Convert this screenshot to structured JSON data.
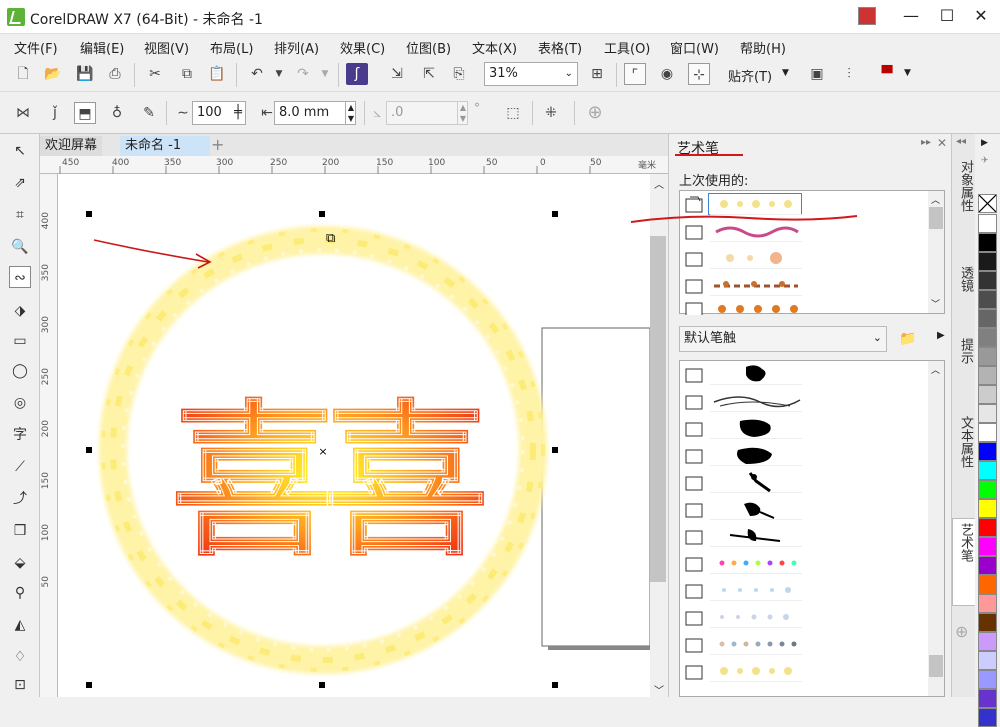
{
  "window": {
    "title": "CorelDRAW X7 (64-Bit) - 未命名 -1"
  },
  "menu": [
    "文件(F)",
    "编辑(E)",
    "视图(V)",
    "布局(L)",
    "排列(A)",
    "效果(C)",
    "位图(B)",
    "文本(X)",
    "表格(T)",
    "工具(O)",
    "窗口(W)",
    "帮助(H)"
  ],
  "toolbar": {
    "zoom": "31%",
    "snap_label": "贴齐(T)"
  },
  "property_bar": {
    "smoothness": "100",
    "width": "8.0 mm",
    "angle": ".0",
    "degree_symbol": "°"
  },
  "doc_tabs": [
    "欢迎屏幕",
    "未命名 -1"
  ],
  "ruler": {
    "h_ticks": [
      "450",
      "400",
      "350",
      "300",
      "250",
      "200",
      "150",
      "100",
      "50",
      "0",
      "50"
    ],
    "h_unit": "毫米",
    "v_ticks": [
      "400",
      "350",
      "300",
      "250",
      "200",
      "150",
      "100",
      "50"
    ]
  },
  "canvas": {
    "art_text": "喜喜"
  },
  "docker": {
    "title": "艺术笔",
    "recent_label": "上次使用的:",
    "category": "默认笔触"
  },
  "side_tabs": [
    "对象属性",
    "透镜",
    "提示",
    "文本属性",
    "艺术笔"
  ],
  "colors": {
    "accent_red": "#d0181e",
    "palette": [
      "#ffffff",
      "#000000",
      "#1a1a1a",
      "#333333",
      "#4d4d4d",
      "#666666",
      "#808080",
      "#999999",
      "#b3b3b3",
      "#cccccc",
      "#e6e6e6",
      "#ffffff",
      "#0000ff",
      "#00ffff",
      "#00ff00",
      "#ffff00",
      "#ff0000",
      "#ff00ff",
      "#9900cc",
      "#ff6600",
      "#ff9999",
      "#663300",
      "#cc99ff",
      "#ccccff",
      "#9999ff",
      "#6633cc",
      "#3333cc"
    ]
  }
}
